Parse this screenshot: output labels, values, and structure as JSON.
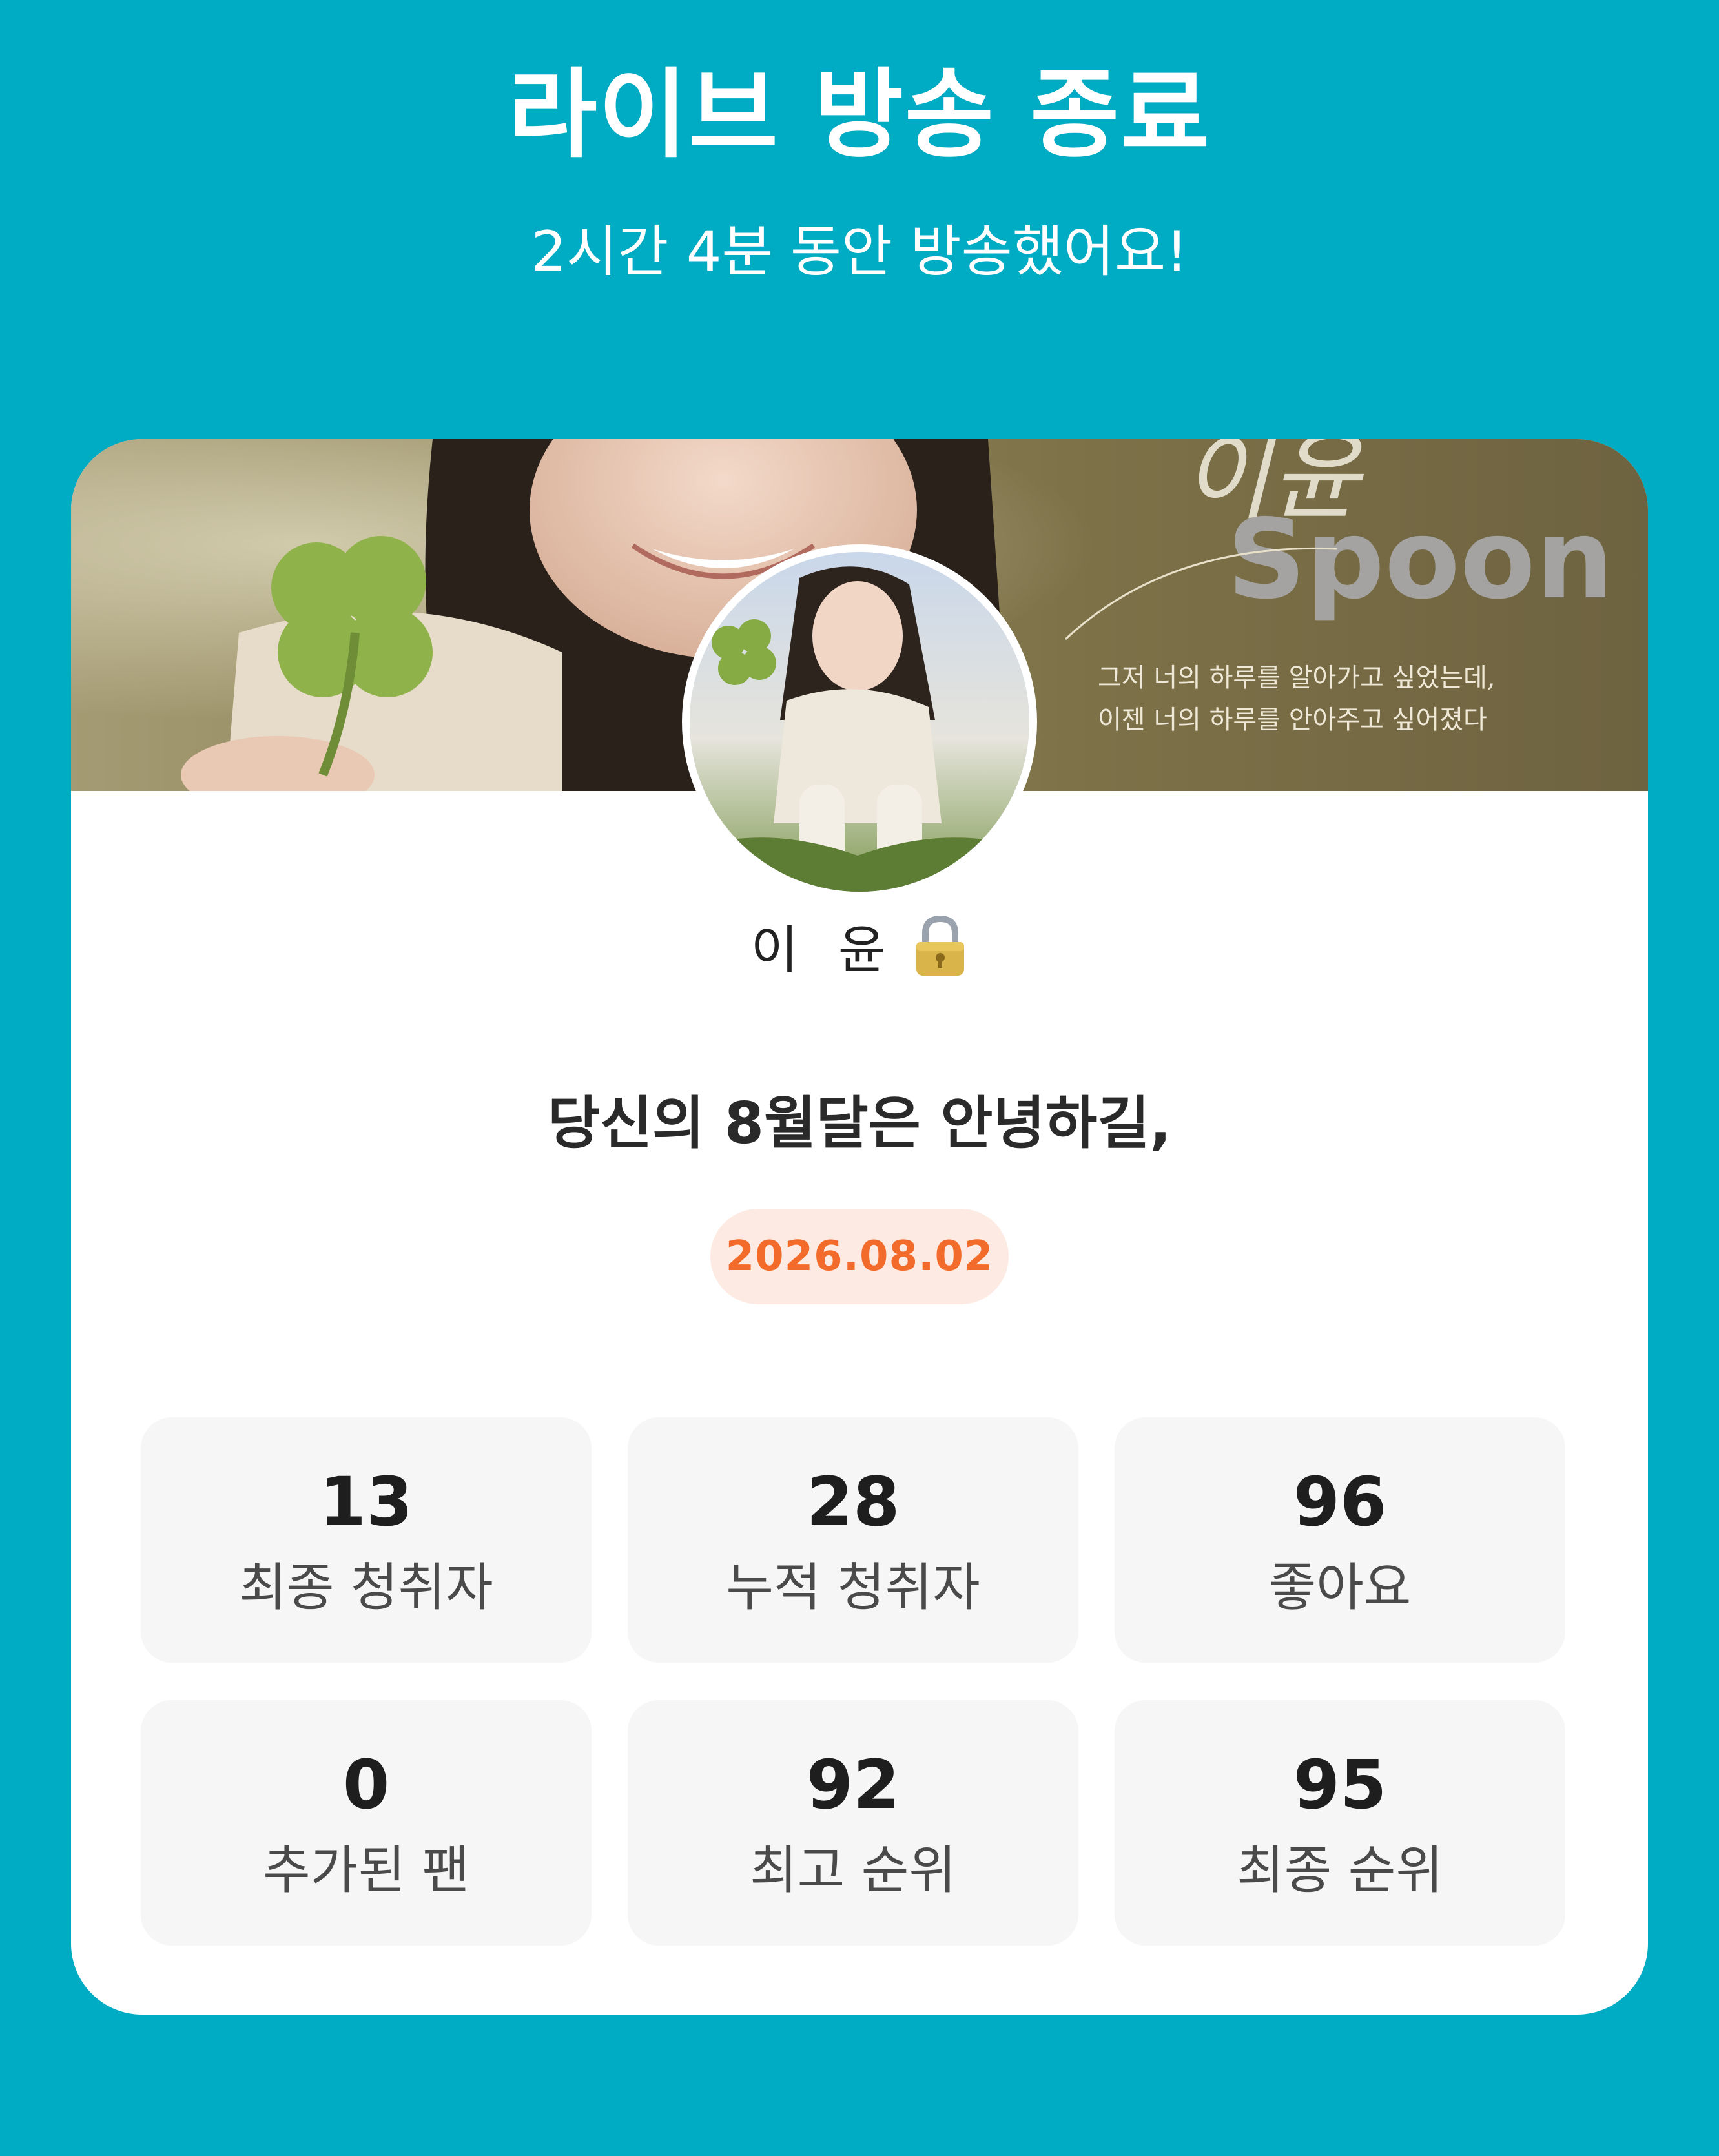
{
  "header": {
    "title": "라이브 방송 종료",
    "subtitle": "2시간 4분 동안 방송했어요!"
  },
  "banner": {
    "handwritten_name": "이윤",
    "logo_text": "Spoon",
    "caption_line1": "그저 너의 하루를 알아가고 싶었는데,",
    "caption_line2": "이젠 너의 하루를 안아주고 싶어졌다"
  },
  "profile": {
    "name": "이 윤",
    "lock_icon": "lock-icon"
  },
  "broadcast": {
    "headline": "당신의 8월달은 안녕하길,",
    "date": "2026.08.02"
  },
  "stats": [
    {
      "value": "13",
      "label": "최종 청취자"
    },
    {
      "value": "28",
      "label": "누적 청취자"
    },
    {
      "value": "96",
      "label": "좋아요"
    },
    {
      "value": "0",
      "label": "추가된 팬"
    },
    {
      "value": "92",
      "label": "최고 순위"
    },
    {
      "value": "95",
      "label": "최종 순위"
    }
  ],
  "colors": {
    "background": "#00abc4",
    "card": "#ffffff",
    "date_text": "#f26b2a",
    "date_pill": "#fdebe3",
    "stat_tile": "#f6f6f6"
  }
}
